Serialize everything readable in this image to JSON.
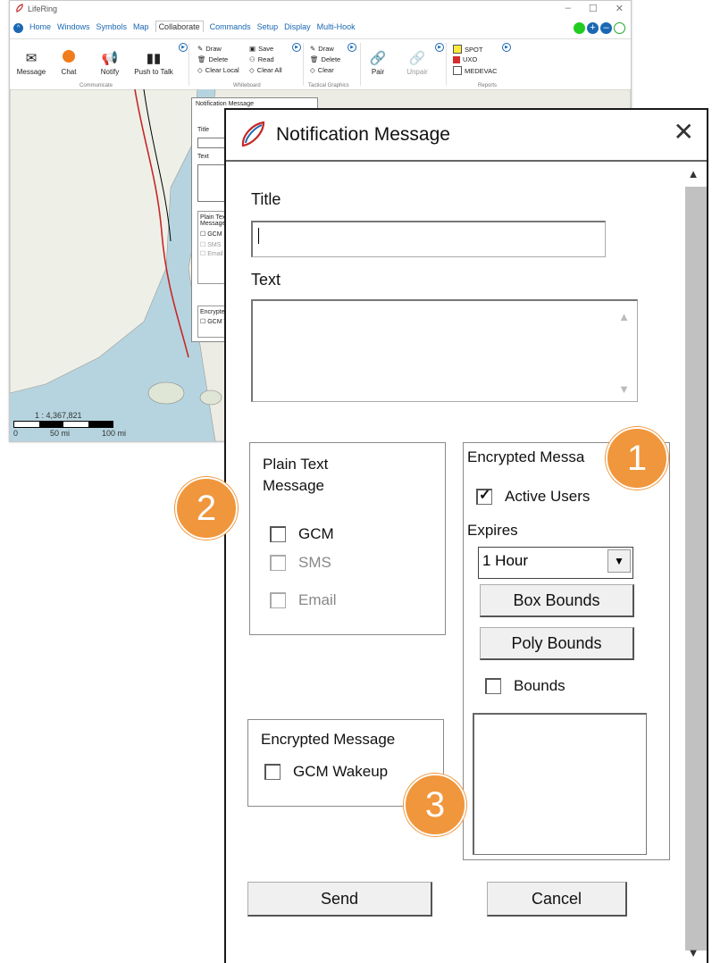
{
  "app": {
    "title": "LifeRing",
    "window_buttons": [
      "–",
      "☐",
      "✕"
    ],
    "menu": [
      "Home",
      "Windows",
      "Symbols",
      "Map",
      "Collaborate",
      "Commands",
      "Setup",
      "Display",
      "Multi-Hook"
    ],
    "active_menu": "Collaborate",
    "ribbon": {
      "communicate": {
        "group": "Communicate",
        "buttons": [
          "Message",
          "Chat",
          "Notify",
          "Push to Talk"
        ]
      },
      "whiteboard": {
        "group": "Whiteboard",
        "items": [
          "Draw",
          "Delete",
          "Clear Local",
          "Save",
          "Read",
          "Clear All"
        ]
      },
      "tactical": {
        "group": "Tactical Graphics",
        "items": [
          "Draw",
          "Delete",
          "Clear"
        ]
      },
      "pair": {
        "items": [
          "Pair",
          "Unpair"
        ]
      },
      "reports": {
        "group": "Reports",
        "items": [
          "SPOT",
          "UXO",
          "MEDEVAC"
        ]
      }
    },
    "scale": {
      "ratio": "1 : 4,367,821",
      "ticks": [
        "0",
        "50 mi",
        "100 mi"
      ]
    },
    "small_dialog": {
      "title": "Notification Message",
      "title_label": "Title",
      "text_label": "Text",
      "plain_label": "Plain Text Message",
      "options": [
        "GCM",
        "SMS",
        "Email"
      ],
      "encrypted_label": "Encrypted",
      "gcm_wakeup": "GCM W"
    }
  },
  "dialog": {
    "title": "Notification Message",
    "title_label": "Title",
    "title_value": "",
    "text_label": "Text",
    "text_value": "",
    "plain_text": {
      "heading": "Plain Text Message",
      "options": [
        {
          "label": "GCM",
          "checked": false,
          "enabled": true
        },
        {
          "label": "SMS",
          "checked": false,
          "enabled": false
        },
        {
          "label": "Email",
          "checked": false,
          "enabled": false
        }
      ]
    },
    "encrypted_right": {
      "heading": "Encrypted Messa",
      "active_users": {
        "label": "Active Users",
        "checked": true
      },
      "expires_label": "Expires",
      "expires_value": "1 Hour",
      "box_bounds": "Box Bounds",
      "poly_bounds": "Poly Bounds",
      "bounds": {
        "label": "Bounds",
        "checked": false
      }
    },
    "encrypted_left": {
      "heading": "Encrypted Message",
      "gcm_wakeup": {
        "label": "GCM Wakeup",
        "checked": false
      }
    },
    "send_label": "Send",
    "cancel_label": "Cancel"
  },
  "callouts": [
    "1",
    "2",
    "3"
  ],
  "colors": {
    "accent": "#1a68b3",
    "callout": "#f0963c",
    "status_green": "#22cc22"
  }
}
